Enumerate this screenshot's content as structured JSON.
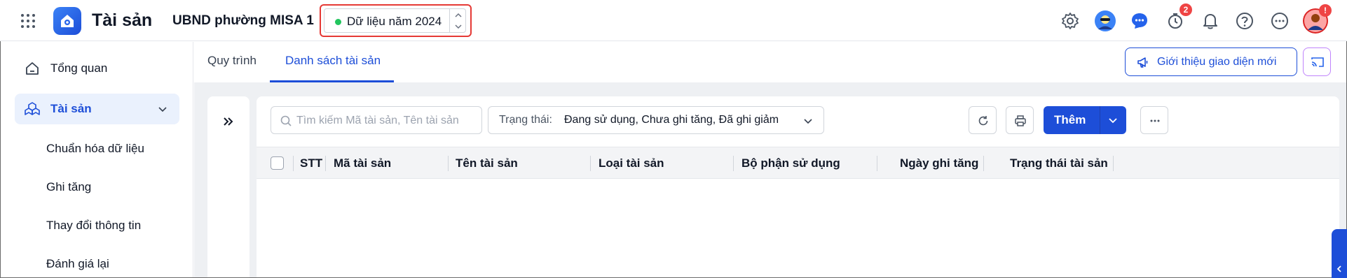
{
  "header": {
    "app_title": "Tài sản",
    "org_name": "UBND phường MISA 1",
    "year_selector": {
      "label": "Dữ liệu năm 2024",
      "status_color": "#22c55e"
    },
    "icons": [
      "settings-icon",
      "assistant-avatar-icon",
      "chat-icon",
      "history-icon",
      "bell-icon",
      "help-icon",
      "more-icon",
      "user-avatar"
    ],
    "history_badge": "2",
    "avatar_badge": "!"
  },
  "sidebar": {
    "items": [
      {
        "label": "Tổng quan",
        "icon": "home-icon"
      },
      {
        "label": "Tài sản",
        "icon": "cubes-icon",
        "active": true,
        "expanded": true
      }
    ],
    "sub_items": [
      {
        "label": "Chuẩn hóa dữ liệu"
      },
      {
        "label": "Ghi tăng"
      },
      {
        "label": "Thay đổi thông tin"
      },
      {
        "label": "Đánh giá lại"
      }
    ]
  },
  "tabs": [
    {
      "label": "Quy trình",
      "active": false
    },
    {
      "label": "Danh sách tài sản",
      "active": true
    }
  ],
  "toolbar": {
    "intro_button": "Giới thiệu giao diện mới",
    "search_placeholder": "Tìm kiếm Mã tài sản, Tên tài sản",
    "status_label": "Trạng thái:",
    "status_value": "Đang sử dụng, Chưa ghi tăng, Đã ghi giảm",
    "add_button": "Thêm"
  },
  "table": {
    "columns": [
      "STT",
      "Mã tài sản",
      "Tên tài sản",
      "Loại tài sản",
      "Bộ phận sử dụng",
      "Ngày ghi tăng",
      "Trạng thái tài sản"
    ],
    "rows": []
  },
  "colors": {
    "accent": "#1d4ed8",
    "highlight_border": "#e53935",
    "badge": "#ef4444"
  }
}
